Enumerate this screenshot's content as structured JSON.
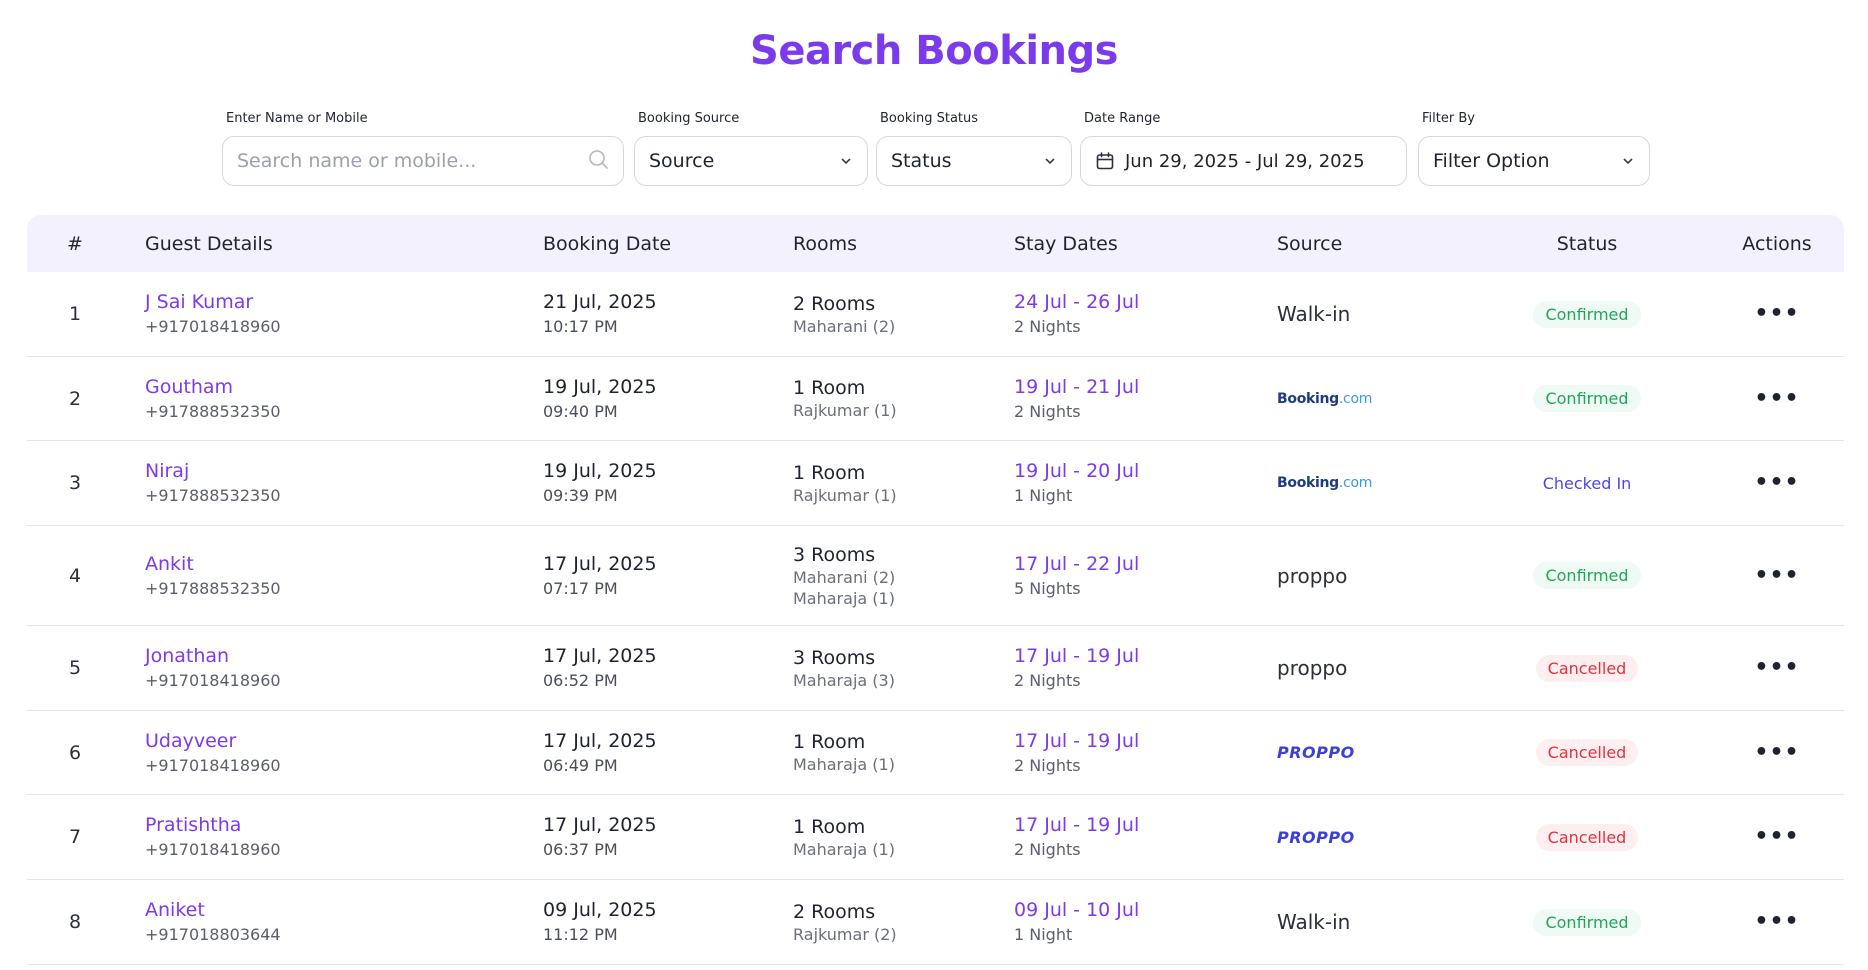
{
  "page": {
    "title": "Search Bookings"
  },
  "filters": {
    "name": {
      "label": "Enter Name or Mobile",
      "placeholder": "Search name or mobile..."
    },
    "source": {
      "label": "Booking Source",
      "value": "Source"
    },
    "status": {
      "label": "Booking Status",
      "value": "Status"
    },
    "date_range": {
      "label": "Date Range",
      "value": "Jun 29, 2025 - Jul 29, 2025"
    },
    "filter_by": {
      "label": "Filter By",
      "value": "Filter Option"
    }
  },
  "table": {
    "headers": {
      "num": "#",
      "guest": "Guest Details",
      "booking_date": "Booking Date",
      "rooms": "Rooms",
      "stay_dates": "Stay Dates",
      "source": "Source",
      "status": "Status",
      "actions": "Actions"
    },
    "rows": [
      {
        "num": "1",
        "name": "J Sai Kumar",
        "phone": "+917018418960",
        "date": "21 Jul, 2025",
        "time": "10:17 PM",
        "rooms": "2 Rooms",
        "room_details": [
          "Maharani (2)"
        ],
        "stay": "24 Jul - 26 Jul",
        "nights": "2 Nights",
        "source_type": "text",
        "source": "Walk-in",
        "status": "Confirmed",
        "status_kind": "confirmed"
      },
      {
        "num": "2",
        "name": "Goutham",
        "phone": "+917888532350",
        "date": "19 Jul, 2025",
        "time": "09:40 PM",
        "rooms": "1 Room",
        "room_details": [
          "Rajkumar (1)"
        ],
        "stay": "19 Jul - 21 Jul",
        "nights": "2 Nights",
        "source_type": "booking",
        "source": "Booking.com",
        "status": "Confirmed",
        "status_kind": "confirmed"
      },
      {
        "num": "3",
        "name": "Niraj",
        "phone": "+917888532350",
        "date": "19 Jul, 2025",
        "time": "09:39 PM",
        "rooms": "1 Room",
        "room_details": [
          "Rajkumar (1)"
        ],
        "stay": "19 Jul - 20 Jul",
        "nights": "1 Night",
        "source_type": "booking",
        "source": "Booking.com",
        "status": "Checked In",
        "status_kind": "checkedin"
      },
      {
        "num": "4",
        "name": "Ankit",
        "phone": "+917888532350",
        "date": "17 Jul, 2025",
        "time": "07:17 PM",
        "rooms": "3 Rooms",
        "room_details": [
          "Maharani (2)",
          "Maharaja (1)"
        ],
        "stay": "17 Jul - 22 Jul",
        "nights": "5 Nights",
        "source_type": "text",
        "source": "proppo",
        "status": "Confirmed",
        "status_kind": "confirmed"
      },
      {
        "num": "5",
        "name": "Jonathan",
        "phone": "+917018418960",
        "date": "17 Jul, 2025",
        "time": "06:52 PM",
        "rooms": "3 Rooms",
        "room_details": [
          "Maharaja (3)"
        ],
        "stay": "17 Jul - 19 Jul",
        "nights": "2 Nights",
        "source_type": "text",
        "source": "proppo",
        "status": "Cancelled",
        "status_kind": "cancelled"
      },
      {
        "num": "6",
        "name": "Udayveer",
        "phone": "+917018418960",
        "date": "17 Jul, 2025",
        "time": "06:49 PM",
        "rooms": "1 Room",
        "room_details": [
          "Maharaja (1)"
        ],
        "stay": "17 Jul - 19 Jul",
        "nights": "2 Nights",
        "source_type": "proppo-logo",
        "source": "PROPPO",
        "status": "Cancelled",
        "status_kind": "cancelled"
      },
      {
        "num": "7",
        "name": "Pratishtha",
        "phone": "+917018418960",
        "date": "17 Jul, 2025",
        "time": "06:37 PM",
        "rooms": "1 Room",
        "room_details": [
          "Maharaja (1)"
        ],
        "stay": "17 Jul - 19 Jul",
        "nights": "2 Nights",
        "source_type": "proppo-logo",
        "source": "PROPPO",
        "status": "Cancelled",
        "status_kind": "cancelled"
      },
      {
        "num": "8",
        "name": "Aniket",
        "phone": "+917018803644",
        "date": "09 Jul, 2025",
        "time": "11:12 PM",
        "rooms": "2 Rooms",
        "room_details": [
          "Rajkumar (2)"
        ],
        "stay": "09 Jul - 10 Jul",
        "nights": "1 Night",
        "source_type": "text",
        "source": "Walk-in",
        "status": "Confirmed",
        "status_kind": "confirmed"
      }
    ]
  },
  "colors": {
    "accent": "#7c3aed",
    "confirmed": "#22a55b",
    "cancelled": "#e0323f",
    "checked_in": "#4f46e5",
    "header_bg": "#f3f1fd"
  }
}
